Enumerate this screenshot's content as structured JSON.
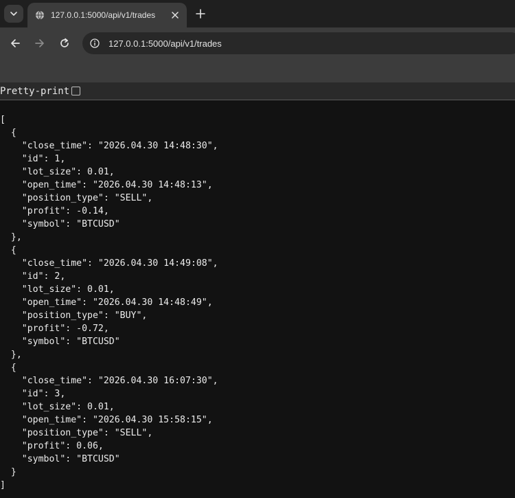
{
  "tabstrip": {
    "tab_title": "127.0.0.1:5000/api/v1/trades",
    "close_icon": "close-icon",
    "new_tab_icon": "plus-icon",
    "search_icon": "chevron-down-icon",
    "favicon": "globe-icon"
  },
  "toolbar": {
    "back_icon": "arrow-left-icon",
    "forward_icon": "arrow-right-icon",
    "reload_icon": "reload-icon",
    "site_info_icon": "info-icon",
    "url": "127.0.0.1:5000/api/v1/trades"
  },
  "viewer": {
    "pretty_print_label": "Pretty-print",
    "pretty_print_checked": false
  },
  "json_lines": [
    "[",
    "  {",
    "    \"close_time\": \"2026.04.30 14:48:30\",",
    "    \"id\": 1,",
    "    \"lot_size\": 0.01,",
    "    \"open_time\": \"2026.04.30 14:48:13\",",
    "    \"position_type\": \"SELL\",",
    "    \"profit\": -0.14,",
    "    \"symbol\": \"BTCUSD\"",
    "  },",
    "  {",
    "    \"close_time\": \"2026.04.30 14:49:08\",",
    "    \"id\": 2,",
    "    \"lot_size\": 0.01,",
    "    \"open_time\": \"2026.04.30 14:48:49\",",
    "    \"position_type\": \"BUY\",",
    "    \"profit\": -0.72,",
    "    \"symbol\": \"BTCUSD\"",
    "  },",
    "  {",
    "    \"close_time\": \"2026.04.30 16:07:30\",",
    "    \"id\": 3,",
    "    \"lot_size\": 0.01,",
    "    \"open_time\": \"2026.04.30 15:58:15\",",
    "    \"position_type\": \"SELL\",",
    "    \"profit\": 0.06,",
    "    \"symbol\": \"BTCUSD\"",
    "  }",
    "]"
  ],
  "colors": {
    "page_background": "#121212",
    "text": "#ececec",
    "tab_active": "#3c3c3c",
    "omnibox": "#282828"
  }
}
